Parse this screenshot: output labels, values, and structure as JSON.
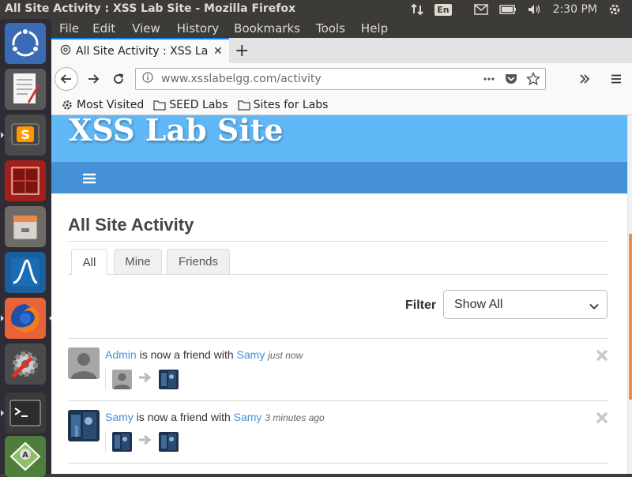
{
  "window": {
    "title": "All Site Activity : XSS Lab Site - Mozilla Firefox",
    "lang": "En",
    "clock": "2:30 PM"
  },
  "menu": [
    "File",
    "Edit",
    "View",
    "History",
    "Bookmarks",
    "Tools",
    "Help"
  ],
  "tab": {
    "title": "All Site Activity : XSS Lab Site"
  },
  "url": {
    "host": "www.xsslabelgg.com",
    "path": "/activity"
  },
  "bookmarks": [
    "Most Visited",
    "SEED Labs",
    "Sites for Labs"
  ],
  "site": {
    "title": "XSS Lab Site"
  },
  "page": {
    "heading": "All Site Activity",
    "tabs": [
      "All",
      "Mine",
      "Friends"
    ],
    "active_tab": "All",
    "filter_label": "Filter",
    "filter_value": "Show All"
  },
  "river": [
    {
      "subject": "Admin",
      "verb": "is now a friend with",
      "object": "Samy",
      "time": "just now"
    },
    {
      "subject": "Samy",
      "verb": "is now a friend with",
      "object": "Samy",
      "time": "3 minutes ago"
    }
  ],
  "launcher_icons": [
    "ubuntu-dash-icon",
    "text-editor-icon",
    "sublime-text-icon",
    "terminator-icon",
    "files-icon",
    "wireshark-icon",
    "firefox-icon",
    "system-settings-icon",
    "terminal-icon",
    "software-updater-icon"
  ],
  "colors": {
    "site_header": "#60b8f7",
    "site_nav": "#4690d6",
    "link": "#4690d6"
  }
}
